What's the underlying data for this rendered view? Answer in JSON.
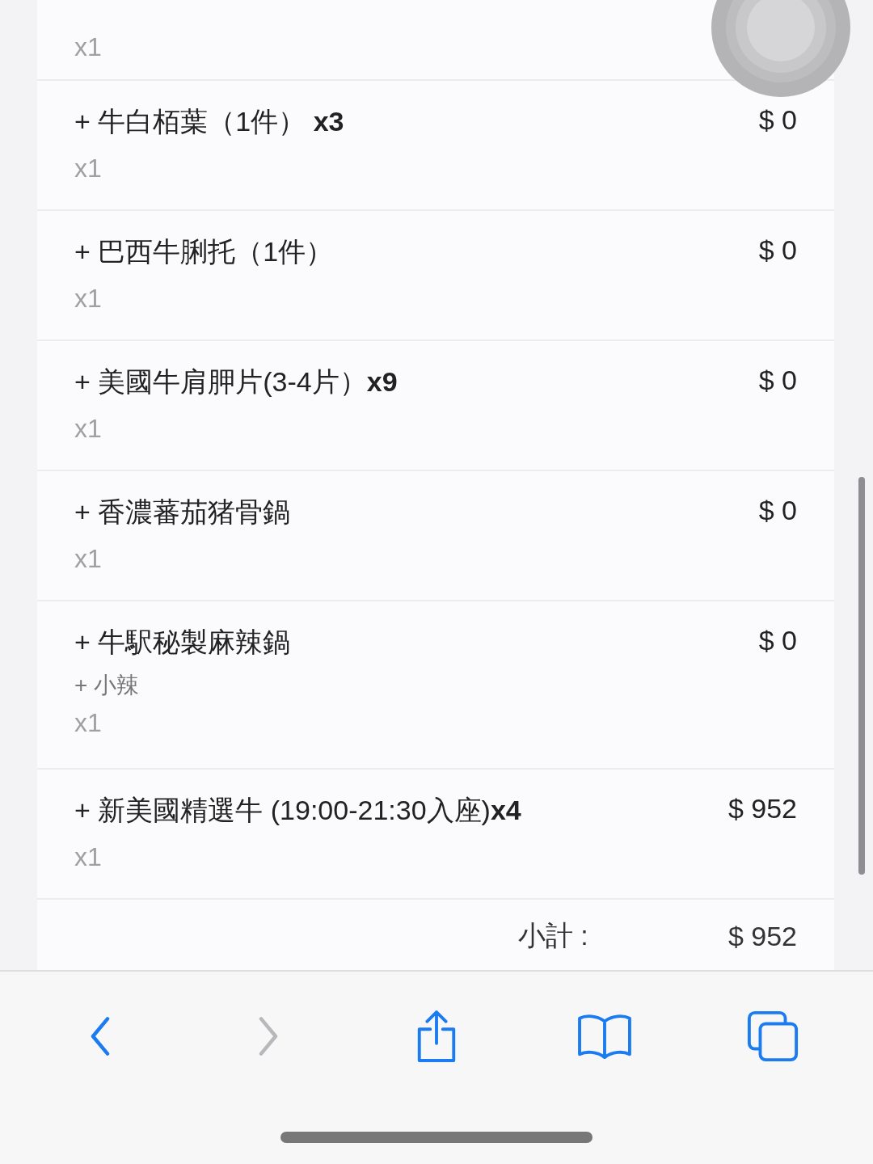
{
  "items": [
    {
      "qty": "x1"
    },
    {
      "name": "+ 牛白栢葉（1件） **x3**",
      "price": "$ 0",
      "qty": "x1"
    },
    {
      "name": "+ 巴西牛脷托（1件）",
      "price": "$ 0",
      "qty": "x1"
    },
    {
      "name": "+ 美國牛肩胛片(3-4片）**x9**",
      "price": "$ 0",
      "qty": "x1"
    },
    {
      "name": "+ 香濃蕃茄猪骨鍋",
      "price": "$ 0",
      "qty": "x1"
    },
    {
      "name": "+ 牛駅秘製麻辣鍋",
      "price": "$ 0",
      "options": [
        "+ 小辣"
      ],
      "qty": "x1"
    },
    {
      "name": "+ 新美國精選牛 (19:00-21:30入座)**x4**",
      "price": "$ 952",
      "qty": "x1"
    }
  ],
  "subtotal": {
    "label": "小計 :",
    "value": "$ 952"
  },
  "toolbar": [
    {
      "kind": "back",
      "disabled": false
    },
    {
      "kind": "forward",
      "disabled": true
    },
    {
      "kind": "share",
      "disabled": false
    },
    {
      "kind": "bookmarks",
      "disabled": false
    },
    {
      "kind": "tabs",
      "disabled": false
    }
  ]
}
